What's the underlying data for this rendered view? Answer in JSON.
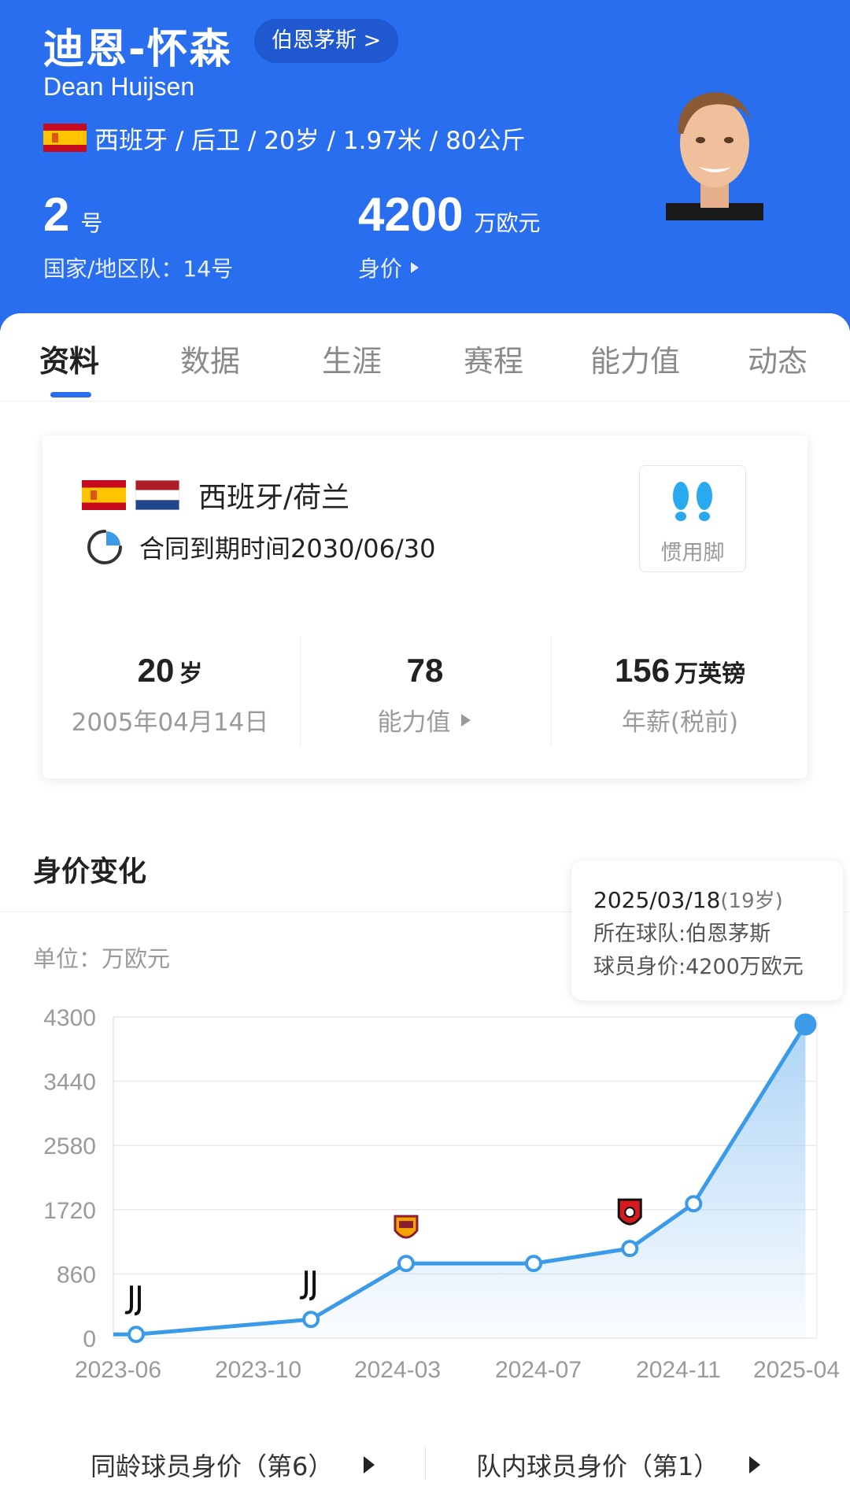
{
  "player": {
    "name_cn": "迪恩-怀森",
    "name_en": "Dean Huijsen",
    "club_chip": "伯恩茅斯 >",
    "meta": "西班牙 / 后卫 / 20岁 / 1.97米 / 80公斤",
    "shirt_number": "2",
    "shirt_unit": "号",
    "national_team_number": "国家/地区队：14号",
    "market_value": "4200",
    "market_value_unit": "万欧元",
    "market_value_label": "身价"
  },
  "tabs": [
    {
      "label": "资料",
      "active": true
    },
    {
      "label": "数据",
      "active": false
    },
    {
      "label": "生涯",
      "active": false
    },
    {
      "label": "赛程",
      "active": false
    },
    {
      "label": "能力值",
      "active": false
    },
    {
      "label": "动态",
      "active": false
    }
  ],
  "info_card": {
    "nationality": "西班牙/荷兰",
    "contract": "合同到期时间2030/06/30",
    "preferred_foot_label": "惯用脚",
    "stats": [
      {
        "main": "20",
        "unit": "岁",
        "sub": "2005年04月14日"
      },
      {
        "main": "78",
        "unit": "",
        "sub": "能力值"
      },
      {
        "main": "156",
        "unit": "万英镑",
        "sub": "年薪(税前)"
      }
    ]
  },
  "chart_section": {
    "title": "身价变化",
    "unit_label": "单位：万欧元",
    "tooltip": {
      "date": "2025/03/18",
      "age": "(19岁)",
      "club": "所在球队:伯恩茅斯",
      "value": "球员身价:4200万欧元"
    }
  },
  "chart_data": {
    "type": "area",
    "y_ticks": [
      "4300",
      "3440",
      "2580",
      "1720",
      "860",
      "0"
    ],
    "x_ticks": [
      "2023-06",
      "2023-10",
      "2024-03",
      "2024-07",
      "2024-11",
      "2025-04"
    ],
    "ylim": [
      0,
      4300
    ],
    "series": [
      {
        "x": [
          "2023-06",
          "2023-12",
          "2024-03",
          "2024-07",
          "2024-10",
          "2024-12",
          "2025-03-18"
        ],
        "values": [
          50,
          250,
          1000,
          1000,
          1200,
          1800,
          4200
        ]
      }
    ],
    "club_markers": [
      {
        "x": "2023-06",
        "club": "juventus-logo"
      },
      {
        "x": "2023-12",
        "club": "juventus-logo"
      },
      {
        "x": "2024-03",
        "club": "roma-logo"
      },
      {
        "x": "2024-10",
        "club": "bournemouth-logo"
      }
    ],
    "colors": {
      "line": "#3c9be9",
      "fill": "#a9d2f6",
      "point_fill": "#ffffff",
      "highlight": "#3c9be9"
    }
  },
  "bottom_links": {
    "same_age": "同龄球员身价（第6）",
    "team": "队内球员身价（第1）"
  },
  "colors": {
    "header_bg": "#2a6ef0",
    "accent": "#2a6ef0",
    "foot_icon": "#29a9f0"
  }
}
